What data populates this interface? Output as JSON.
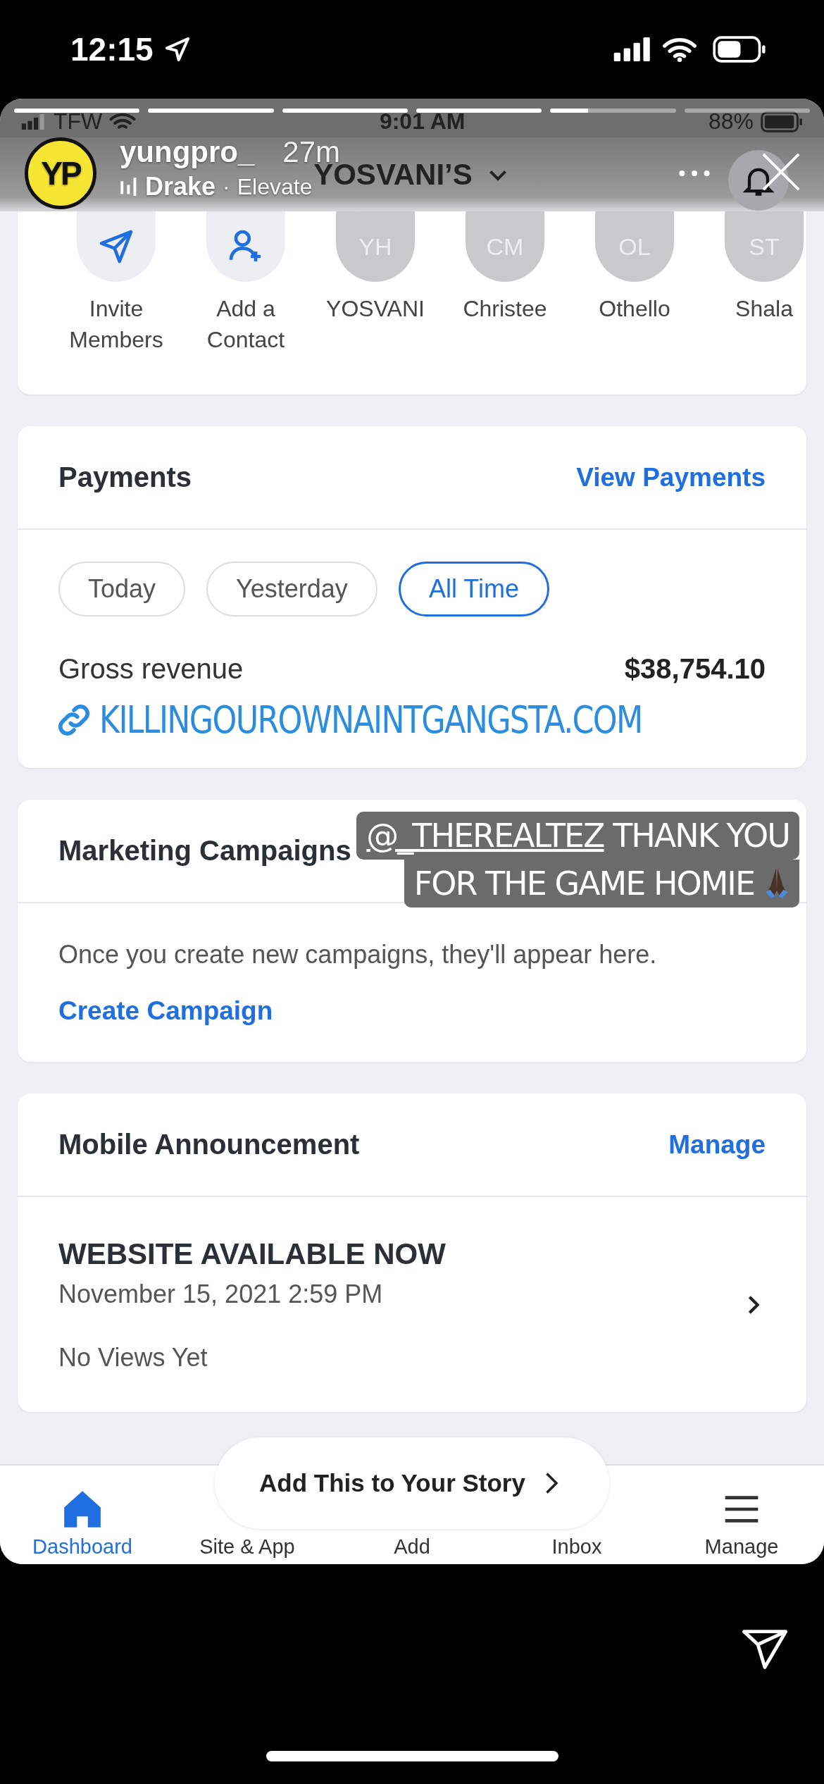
{
  "status_bar": {
    "time": "12:15"
  },
  "inner_status_bar": {
    "carrier": "TFW",
    "time": "9:01 AM",
    "battery": "88%"
  },
  "story": {
    "segments": [
      {
        "level": 1
      },
      {
        "level": 1
      },
      {
        "level": 1
      },
      {
        "level": 1
      },
      {
        "level": 0.3
      },
      {
        "level": 0
      }
    ],
    "avatar": "YP",
    "username": "yungpro_",
    "age": "27m",
    "artist": "Drake",
    "separator": "·",
    "song": "Elevate"
  },
  "site_header": {
    "title": "YOSVANI’S"
  },
  "members": [
    {
      "kind": "invite",
      "label": "Invite Members"
    },
    {
      "kind": "contact",
      "label": "Add a Contact"
    },
    {
      "kind": "member",
      "initials": "YH",
      "label": "YOSVANI"
    },
    {
      "kind": "member",
      "initials": "CM",
      "label": "Christee"
    },
    {
      "kind": "member",
      "initials": "OL",
      "label": "Othello"
    },
    {
      "kind": "member",
      "initials": "ST",
      "label": "Shala"
    }
  ],
  "payments": {
    "title": "Payments",
    "action": "View Payments",
    "filters": [
      {
        "label": "Today",
        "selected": false
      },
      {
        "label": "Yesterday",
        "selected": false
      },
      {
        "label": "All Time",
        "selected": true
      }
    ],
    "metric_label": "Gross revenue",
    "metric_value": "$38,754.10"
  },
  "link_sticker": "KILLINGOUROWNAINTGANGSTA.COM",
  "marketing": {
    "title": "Marketing Campaigns",
    "message": "Once you create new campaigns, they'll appear here.",
    "action": "Create Campaign"
  },
  "caption": {
    "mention": "@_THEREALTEZ",
    "line1": "THANK YOU",
    "line2": "FOR THE GAME HOMIE"
  },
  "announcement": {
    "title": "Mobile Announcement",
    "action": "Manage",
    "headline": "WEBSITE AVAILABLE NOW",
    "date": "November 15, 2021 2:59 PM",
    "views": "No Views Yet"
  },
  "nav": [
    {
      "kind": "dashboard",
      "label": "Dashboard",
      "selected": true
    },
    {
      "kind": "site",
      "label": "Site & App",
      "selected": false
    },
    {
      "kind": "add",
      "label": "Add",
      "selected": false
    },
    {
      "kind": "inbox",
      "label": "Inbox",
      "selected": false
    },
    {
      "kind": "manage",
      "label": "Manage",
      "selected": false
    }
  ],
  "story_prompt": "Add This to Your Story"
}
